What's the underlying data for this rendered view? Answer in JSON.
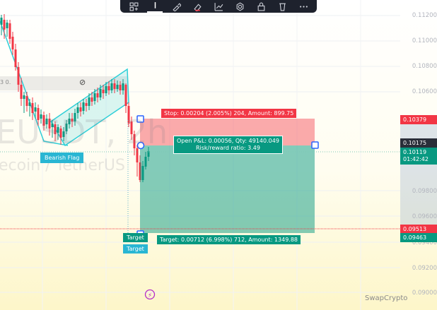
{
  "toolbar": {
    "buttons": [
      "multi-layout-icon",
      "line-tool-icon",
      "brush-icon",
      "eraser-icon",
      "chart-add-icon",
      "settings-icon",
      "lock-icon",
      "trash-icon",
      "more-icon"
    ]
  },
  "watermark": {
    "symbol": "EUSDT, 2h",
    "name": "ecoin / TetherUS"
  },
  "price_axis": [
    "0.11200",
    "0.11000",
    "0.10800",
    "0.10600",
    "0.09800",
    "0.09600",
    "0.09400",
    "0.09200",
    "0.09000"
  ],
  "markers": {
    "stop": {
      "value": "0.10379",
      "color": "#f23645"
    },
    "entry": {
      "value": "0.10175",
      "color": "#2a2e39"
    },
    "current": {
      "value": "0.10119",
      "countdown": "01:42:42",
      "color": "#089981"
    },
    "line_red": {
      "value": "0.09513",
      "color": "#f23645"
    },
    "target": {
      "value": "0.09463",
      "color": "#089981"
    }
  },
  "position": {
    "stop_label": "Stop: 0.00204 (2.005%) 204, Amount: 899.75",
    "pnl_line1": "Open P&L: 0.00056, Qty: 49140.049",
    "pnl_line2": "Risk/reward ratio: 3.49",
    "target_label": "Target: 0.00712 (6.998%) 712, Amount: 1349.88"
  },
  "annotations": {
    "bearish_flag": "Bearish Flag",
    "target_a": "Target",
    "target_b": "Target",
    "fib_label": "3 0."
  },
  "credit": "SwapCrypto",
  "colors": {
    "stop_zone": "rgba(242,54,69,0.42)",
    "profit_zone": "rgba(8,153,129,0.5)",
    "flag": "#2ecfd8",
    "candle_up": "#089981",
    "candle_down": "#f23645"
  }
}
